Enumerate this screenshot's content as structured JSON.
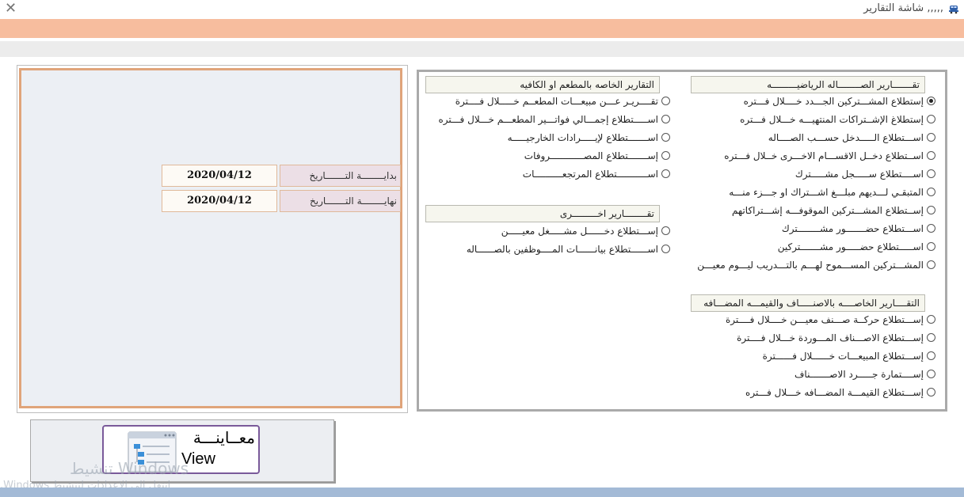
{
  "window": {
    "title": ",,,,, شاشة التقارير",
    "close_glyph": "✕",
    "app_icon": "car-icon"
  },
  "dates": {
    "start_label": "بدايــــــــة التـــــــاريخ",
    "start_value": "2020/04/12",
    "end_label": "نهايــــــــة التـــــــاريخ",
    "end_value": "2020/04/12"
  },
  "gym_reports": {
    "title": "تقـــــــارير الصــــــــاله الرياضيـــــــــه",
    "items": [
      "إستطلاع المشـــتركين الجـــدد خــــلال فـــتره",
      "إستطلاغ الإشــتراكات المنتهيـــه خـــلال فـــتره",
      "اســـتطلاع الـــــدخل حســـب الصــــاله",
      "اســتطلاع دخــل الاقســـام الاخـــرى خــلال فـــتره",
      "اســــتطلاع ســـــجل مشـــــترك",
      "المتبقـي لـــديهم مبلـــغ اشـــتراك او جـــزء منـــه",
      "إســتطلاع المشـــتركين الموقوفـــه إشـــتراكاتهم",
      "اســـتطلاع حضـــــــور مشــــــــترك",
      "اســـــتطلاع حضـــــور مشـــــــتركين",
      "المشـــتركين المســـموح لهـــم بالتـــدريب ليـــوم معيـــن"
    ],
    "selected_index": 0
  },
  "restaurant_reports": {
    "title": "التقارير الخاصه بالمطعم او الكافيه",
    "items": [
      "تقــــريـر عـــن مبيعـــات المطعــم خـــــلال فــــترة",
      "اســـــتطلاع إجمـــالي فواتـــير المطعـــم خـــلال فـــتره",
      "اســـــــتطلاع لإيـــــرادات الخارجيـــــه",
      "إســـــــتطلاع المصــــــــــــروفات",
      "اســـــــــــتطلاع المرتجعــــــــــات"
    ]
  },
  "other_reports": {
    "title": "تقــــــــارير اخـــــــــرى",
    "items": [
      "إســـتطلاع دخــــــل مشـــــغل معيـــــن",
      "اســــــتطلاع بيانــــــات المــــوظفين بالصــــــاله"
    ]
  },
  "items_reports": {
    "title": "التقــــارير الخاصــــه بالاصنـــــاف والقيمـــه المضـــافه",
    "items": [
      "إســـتطلاع حركــة صـــنف معيـــن خــــلال فــــترة",
      "إســـتطلاع الاصـــناف المـــوردة خـــلال فــــترة",
      "إســـتطلاع المبيعـــات خــــــلال فــــــترة",
      "إســــتمارة جـــــرد الاصـــــــناف",
      "إســـتطلاع القيمـــة المضـــافه خـــلال فـــتره"
    ]
  },
  "preview": {
    "label_ar": "معــاينـــة",
    "label_en": "View",
    "icon": "document-list-icon"
  },
  "watermark": {
    "line1": "تنشيط Windows",
    "line2": "انتقل إلى الإعدادات لتنشيط Windows."
  }
}
